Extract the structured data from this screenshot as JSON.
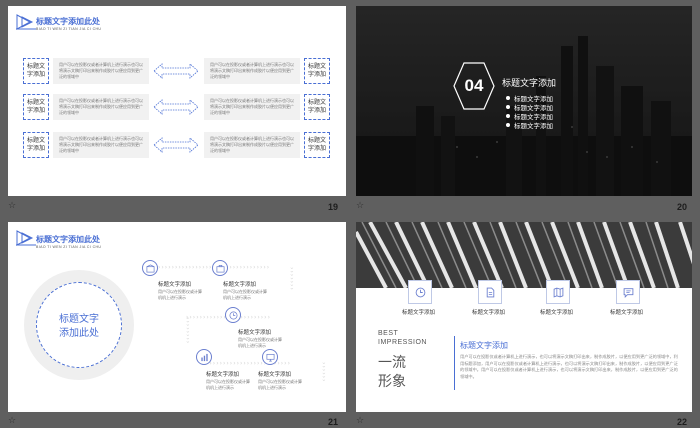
{
  "slides": {
    "s19": {
      "number": "19",
      "header_title": "标题文字添加此处",
      "header_sub": "BIAO TI WEN ZI TIAN JIA CI CHU",
      "tag_label": "标题文字添加",
      "body_text": "用户可以在投影仪或者计算机上进行演示也可以将演示文稿打印出来制作成胶片以便应用到更广泛的领域中",
      "tags": [
        "标题文字添加",
        "标题文字添加",
        "标题文字添加",
        "标题文字添加",
        "标题文字添加",
        "标题文字添加"
      ],
      "texts": [
        "用户可以在投影仪或者计算机上进行演示也可以将演示文稿打印出来制作成胶片以便应用到更广泛的领域中",
        "用户可以在投影仪或者计算机上进行演示也可以将演示文稿打印出来制作成胶片以便应用到更广泛的领域中",
        "用户可以在投影仪或者计算机上进行演示也可以将演示文稿打印出来制作成胶片以便应用到更广泛的领域中",
        "用户可以在投影仪或者计算机上进行演示也可以将演示文稿打印出来制作成胶片以便应用到更广泛的领域中",
        "用户可以在投影仪或者计算机上进行演示也可以将演示文稿打印出来制作成胶片以便应用到更广泛的领域中",
        "用户可以在投影仪或者计算机上进行演示也可以将演示文稿打印出来制作成胶片以便应用到更广泛的领域中"
      ]
    },
    "s20": {
      "number": "20",
      "section_num": "04",
      "title": "标题文字添加",
      "items": [
        "标题文字添加",
        "标题文字添加",
        "标题文字添加",
        "标题文字添加"
      ]
    },
    "s21": {
      "number": "21",
      "header_title": "标题文字添加此处",
      "header_sub": "BIAO TI WEN ZI TIAN JIA CI CHU",
      "circle_line1": "标题文字",
      "circle_line2": "添加此处",
      "nodes": [
        {
          "label": "标题文字添加",
          "desc1": "用户可以在投影仪或计算",
          "desc2": "机机上进行演示"
        },
        {
          "label": "标题文字添加",
          "desc1": "用户可以在投影仪或计算",
          "desc2": "机机上进行演示"
        },
        {
          "label": "标题文字添加",
          "desc1": "用户可以在投影仪或计算",
          "desc2": "机机上进行演示"
        },
        {
          "label": "标题文字添加",
          "desc1": "用户可以在投影仪或计算",
          "desc2": "机机上进行演示"
        },
        {
          "label": "标题文字添加",
          "desc1": "用户可以在投影仪或计算",
          "desc2": "机机上进行演示"
        }
      ]
    },
    "s22": {
      "number": "22",
      "icons": [
        {
          "label": "标题文字添加",
          "icon": "clock-icon"
        },
        {
          "label": "标题文字添加",
          "icon": "document-icon"
        },
        {
          "label": "标题文字添加",
          "icon": "map-icon"
        },
        {
          "label": "标题文字添加",
          "icon": "chat-icon"
        }
      ],
      "best": "BEST",
      "impression": "IMPRESSION",
      "big1": "一流",
      "big2": "形象",
      "title": "标题文字添加",
      "paragraph": "用户可以在投影仪或者计算机上进行演示，也可以将演示文稿打印出来，制作成胶片，以便应用到更广泛的领域中，利用标题添加，用户可以在投影仪或者计算机上进行演示，也可以将演示文稿打印出来，制作成胶片，以便应用到更广泛的领域中。用户可以在投影仪或者计算机上进行演示，也可以将演示文稿打印出来，制作成胶片，以便应用到更广泛的领域中。"
    }
  },
  "colors": {
    "accent": "#4a6fd4",
    "background": "#5f5f5f",
    "dark_slide": "#2b2b2b"
  }
}
